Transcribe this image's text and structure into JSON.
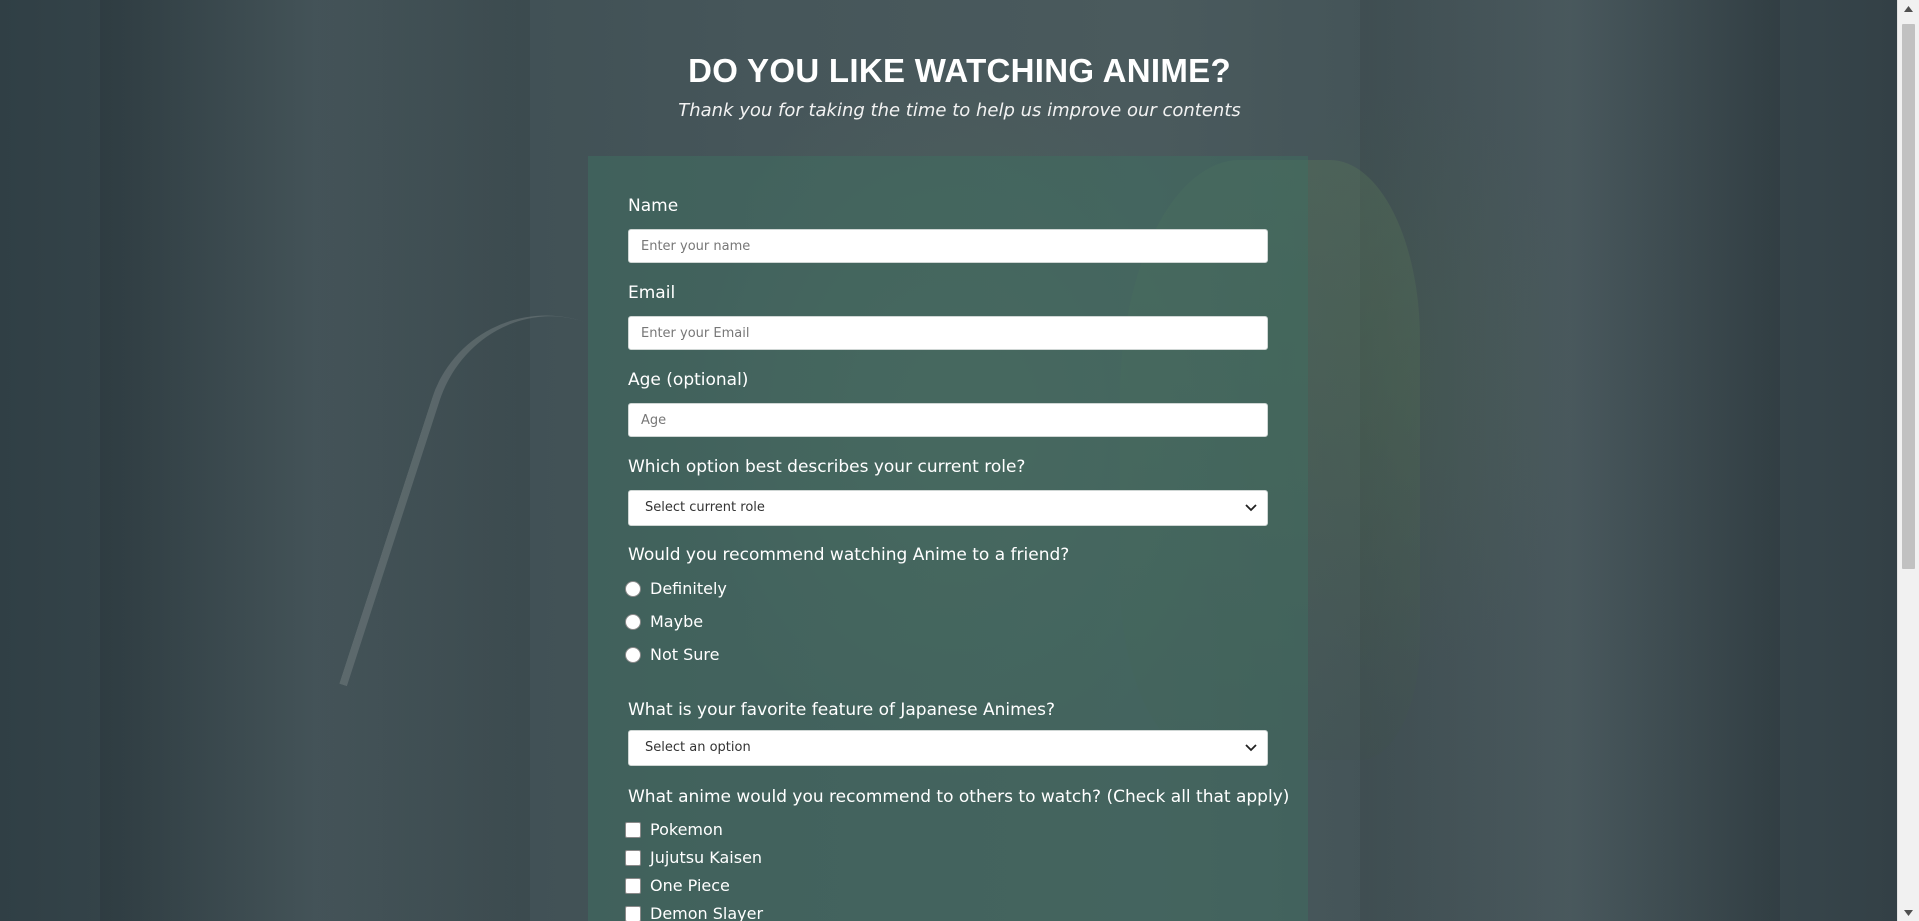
{
  "page": {
    "title": "DO YOU LIKE WATCHING ANIME?",
    "subtitle": "Thank you for taking the time to help us improve our contents"
  },
  "form": {
    "name": {
      "label": "Name",
      "placeholder": "Enter your name"
    },
    "email": {
      "label": "Email",
      "placeholder": "Enter your Email"
    },
    "age": {
      "label": "Age (optional)",
      "placeholder": "Age"
    },
    "role": {
      "label": "Which option best describes your current role?",
      "selected": "Select current role"
    },
    "recommend": {
      "label": "Would you recommend watching Anime to a friend?",
      "options": [
        "Definitely",
        "Maybe",
        "Not Sure"
      ]
    },
    "feature": {
      "label": "What is your favorite feature of Japanese Animes?",
      "selected": "Select an option"
    },
    "anime": {
      "label": "What anime would you recommend to others to watch? (Check all that apply)",
      "options": [
        "Pokemon",
        "Jujutsu Kaisen",
        "One Piece",
        "Demon Slayer"
      ]
    }
  },
  "icons": {
    "select_arrow": "chevron-down-icon",
    "scroll_up": "triangle-up-icon",
    "scroll_down": "triangle-down-icon"
  },
  "colors": {
    "card": "#406E60",
    "text": "#ffffff",
    "input_bg": "#ffffff"
  }
}
